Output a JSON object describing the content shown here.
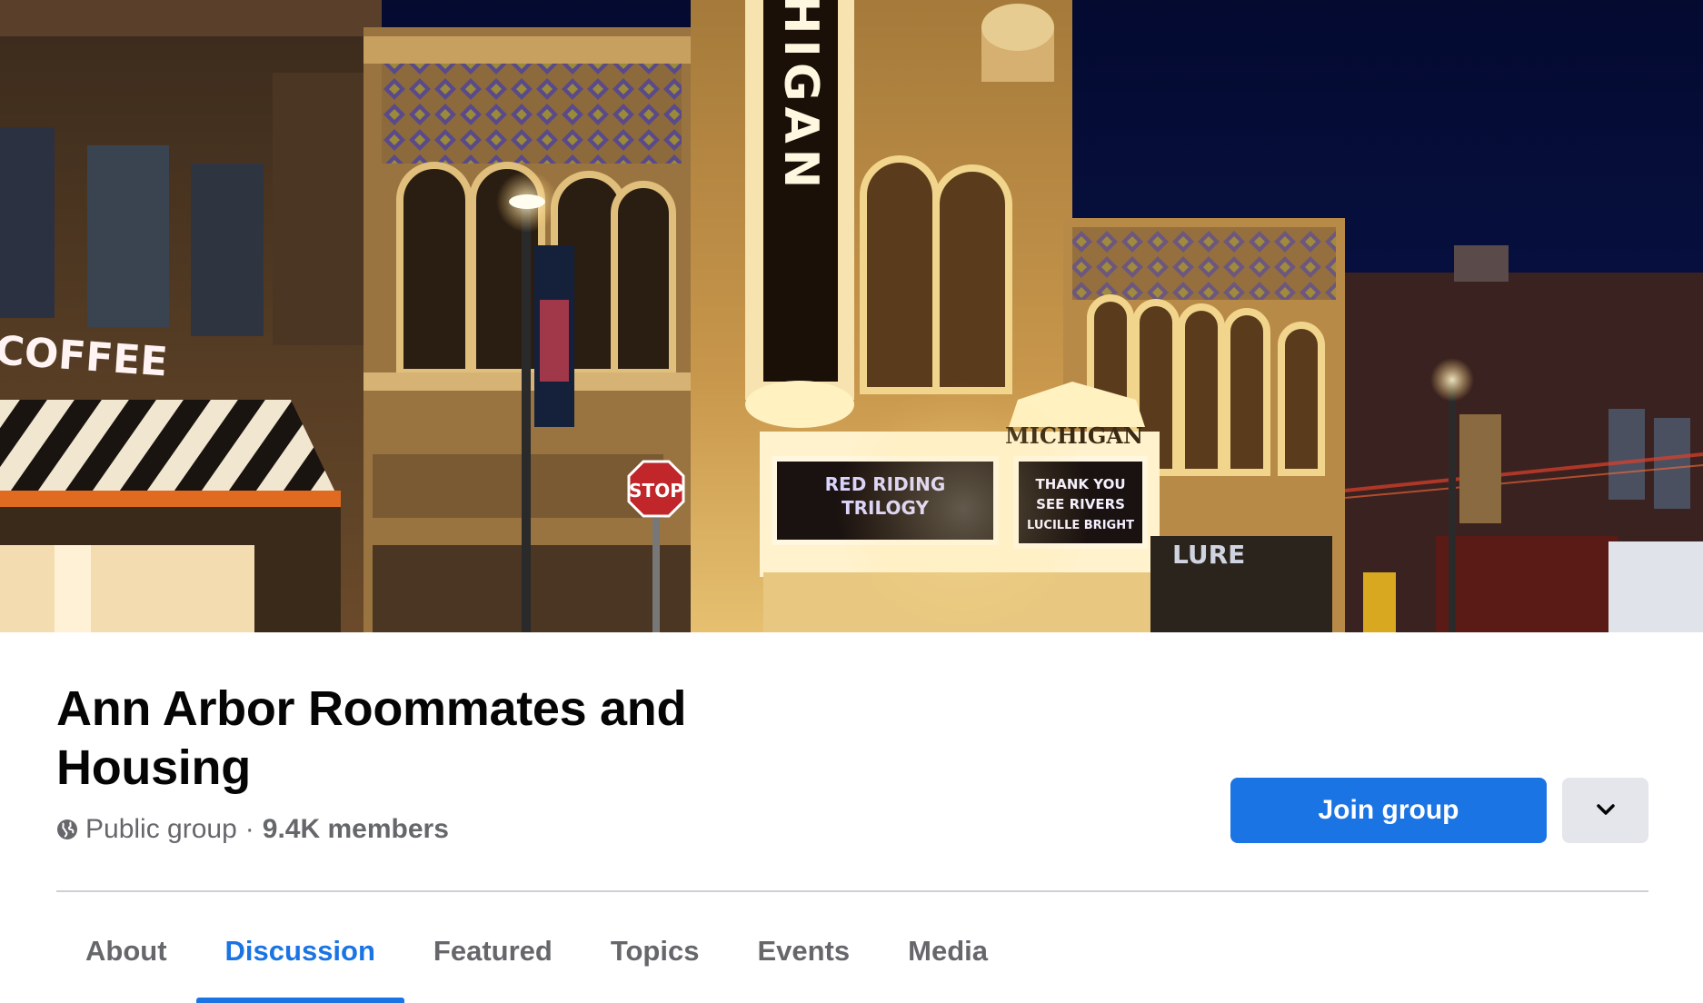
{
  "cover": {
    "image_name": "michigan-theater-night-photo",
    "signs": {
      "coffee": "COFFEE",
      "vertical": "MICHIGAN",
      "stop": "STOP",
      "marquee_left": [
        "RED RIDING",
        "TRILOGY"
      ],
      "marquee_crest": "MICHIGAN",
      "marquee_right": [
        "THANK YOU",
        "SEE RIVERS",
        "LUCILLE BRIGHT"
      ],
      "storefront": "LURE"
    }
  },
  "group": {
    "title": "Ann Arbor Roommates and Housing",
    "privacy": "Public group",
    "separator": "·",
    "members": "9.4K members"
  },
  "actions": {
    "join_label": "Join group",
    "more_icon": "chevron-down-icon"
  },
  "tabs": [
    {
      "label": "About",
      "active": false
    },
    {
      "label": "Discussion",
      "active": true
    },
    {
      "label": "Featured",
      "active": false
    },
    {
      "label": "Topics",
      "active": false
    },
    {
      "label": "Events",
      "active": false
    },
    {
      "label": "Media",
      "active": false
    }
  ],
  "colors": {
    "accent": "#1b74e4",
    "text_primary": "#050505",
    "text_secondary": "#65676b",
    "secondary_button": "#e4e6eb",
    "divider": "#ced0d4"
  }
}
